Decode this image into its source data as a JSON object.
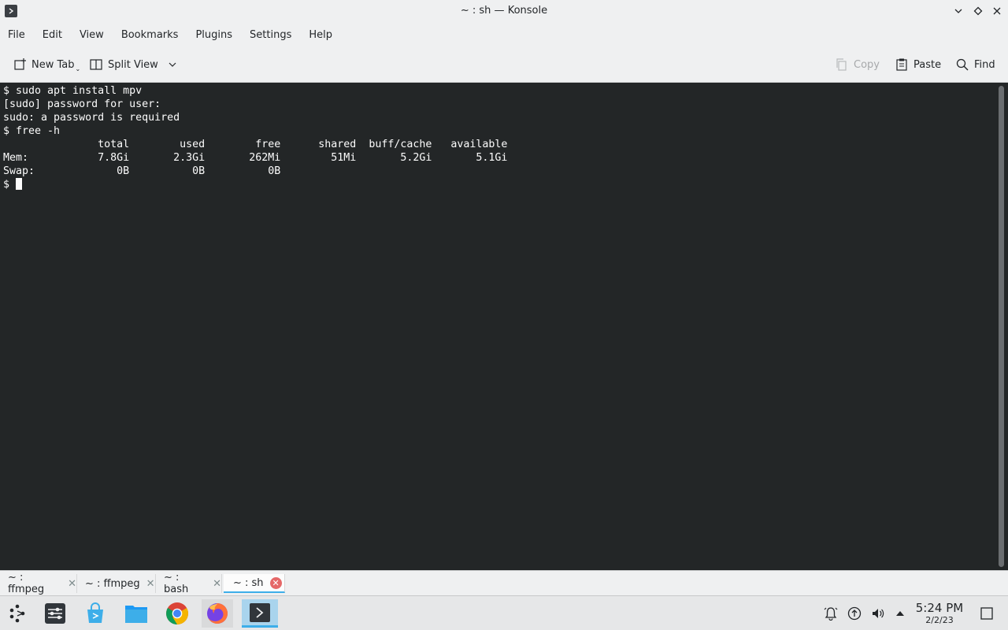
{
  "window": {
    "title": "~ : sh — Konsole"
  },
  "menu": {
    "items": [
      "File",
      "Edit",
      "View",
      "Bookmarks",
      "Plugins",
      "Settings",
      "Help"
    ]
  },
  "toolbar": {
    "new_tab": "New Tab",
    "split_view": "Split View",
    "copy": "Copy",
    "paste": "Paste",
    "find": "Find"
  },
  "terminal": {
    "lines": [
      "$ sudo apt install mpv",
      "[sudo] password for user:",
      "sudo: a password is required",
      "$ free -h",
      "               total        used        free      shared  buff/cache   available",
      "Mem:           7.8Gi       2.3Gi       262Mi        51Mi       5.2Gi       5.1Gi",
      "Swap:             0B          0B          0B"
    ],
    "prompt": "$ "
  },
  "tabs": [
    {
      "label": "~ : ffmpeg",
      "active": false
    },
    {
      "label": "~ : ffmpeg",
      "active": false
    },
    {
      "label": "~ : bash",
      "active": false
    },
    {
      "label": "~ : sh",
      "active": true
    }
  ],
  "taskbar": {
    "apps": [
      "application-launcher-icon",
      "system-settings-icon",
      "discover-store-icon",
      "file-manager-icon",
      "chrome-icon",
      "firefox-icon",
      "konsole-icon"
    ],
    "clock_time": "5:24 PM",
    "clock_date": "2/2/23"
  },
  "colors": {
    "terminal_bg": "#232627",
    "terminal_fg": "#fcfcfc",
    "accent": "#3daee9",
    "chrome_bg": "#eff0f1"
  }
}
